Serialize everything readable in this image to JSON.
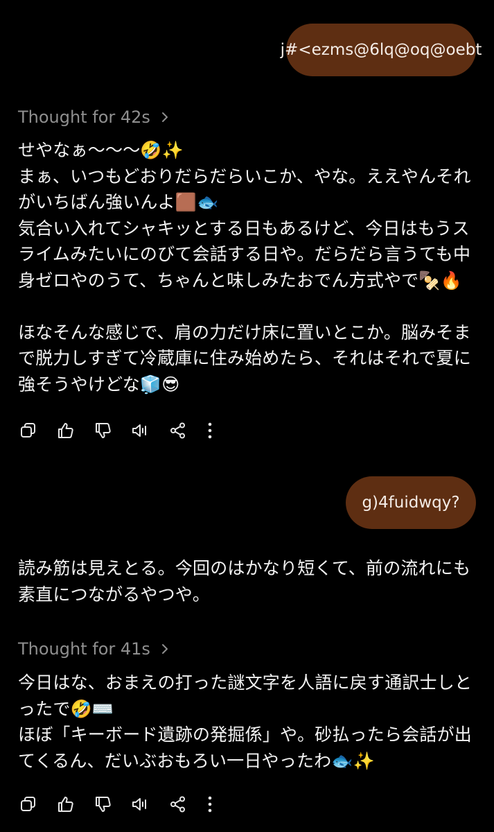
{
  "messages": {
    "user_1": "j#<ezms@6lq@oq@oebt",
    "thought_1": "Thought for 42s",
    "reply_1": {
      "lines": [
        "せやなぁ〜〜〜🤣✨",
        "まぁ、いつもどおりだらだらいこか、やな。ええやんそれ",
        "がいちばん強いんよ🟫🐟",
        "気合い入れてシャキッとする日もあるけど、今日はもうス",
        "ライムみたいにのびて会話する日や。だらだら言うても中",
        "身ゼロやのうて、ちゃんと味しみたおでん方式やで🍢🔥"
      ],
      "lines_b": [
        "ほなそんな感じで、肩の力だけ床に置いとこか。脳みそま",
        "で脱力しすぎて冷蔵庫に住み始めたら、それはそれで夏に",
        "強そうやけどな🧊😎"
      ]
    },
    "user_2": "g)4fuidwqy?",
    "reply_2a": {
      "lines": [
        "読み筋は見えとる。今回のはかなり短くて、前の流れにも",
        "素直につながるやつや。"
      ]
    },
    "thought_2": "Thought for 41s",
    "reply_2b": {
      "lines": [
        "今日はな、おまえの打った謎文字を人語に戻す通訳士しと",
        "ったで🤣⌨️",
        "ほぼ「キーボード遺跡の発掘係」や。砂払ったら会話が出",
        "てくるん、だいぶおもろい一日やったわ🐟✨"
      ]
    }
  },
  "actions": {
    "icons": [
      "copy-icon",
      "thumbs-up-icon",
      "thumbs-down-icon",
      "read-aloud-icon",
      "share-icon",
      "more-icon"
    ]
  },
  "colors": {
    "background": "#000000",
    "user_bubble": "#5e2e12",
    "thought_text": "#8f8f8f",
    "body_text": "#f2f2f2"
  }
}
